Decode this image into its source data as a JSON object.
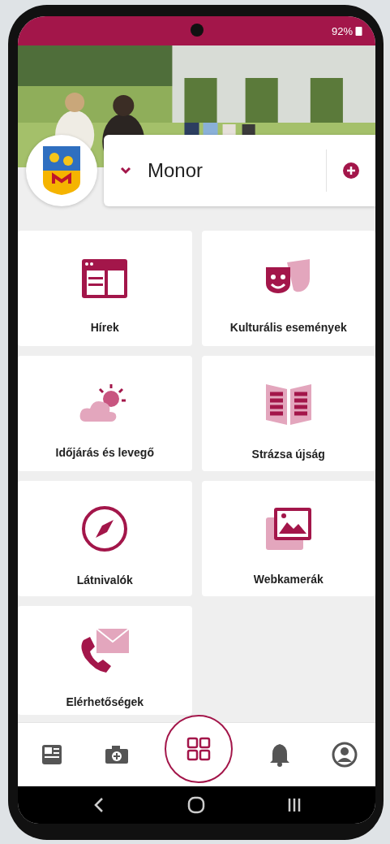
{
  "status_bar": {
    "battery": "92%"
  },
  "city_selector": {
    "value": "Monor"
  },
  "tiles": [
    {
      "label": "Hírek"
    },
    {
      "label": "Kulturális események"
    },
    {
      "label": "Időjárás és levegő"
    },
    {
      "label": "Strázsa újság"
    },
    {
      "label": "Látnivalók"
    },
    {
      "label": "Webkamerák"
    },
    {
      "label": "Elérhetőségek"
    }
  ],
  "bottom_nav": [
    {
      "selected": false
    },
    {
      "selected": false
    },
    {
      "selected": true
    },
    {
      "selected": false
    },
    {
      "selected": false
    }
  ]
}
